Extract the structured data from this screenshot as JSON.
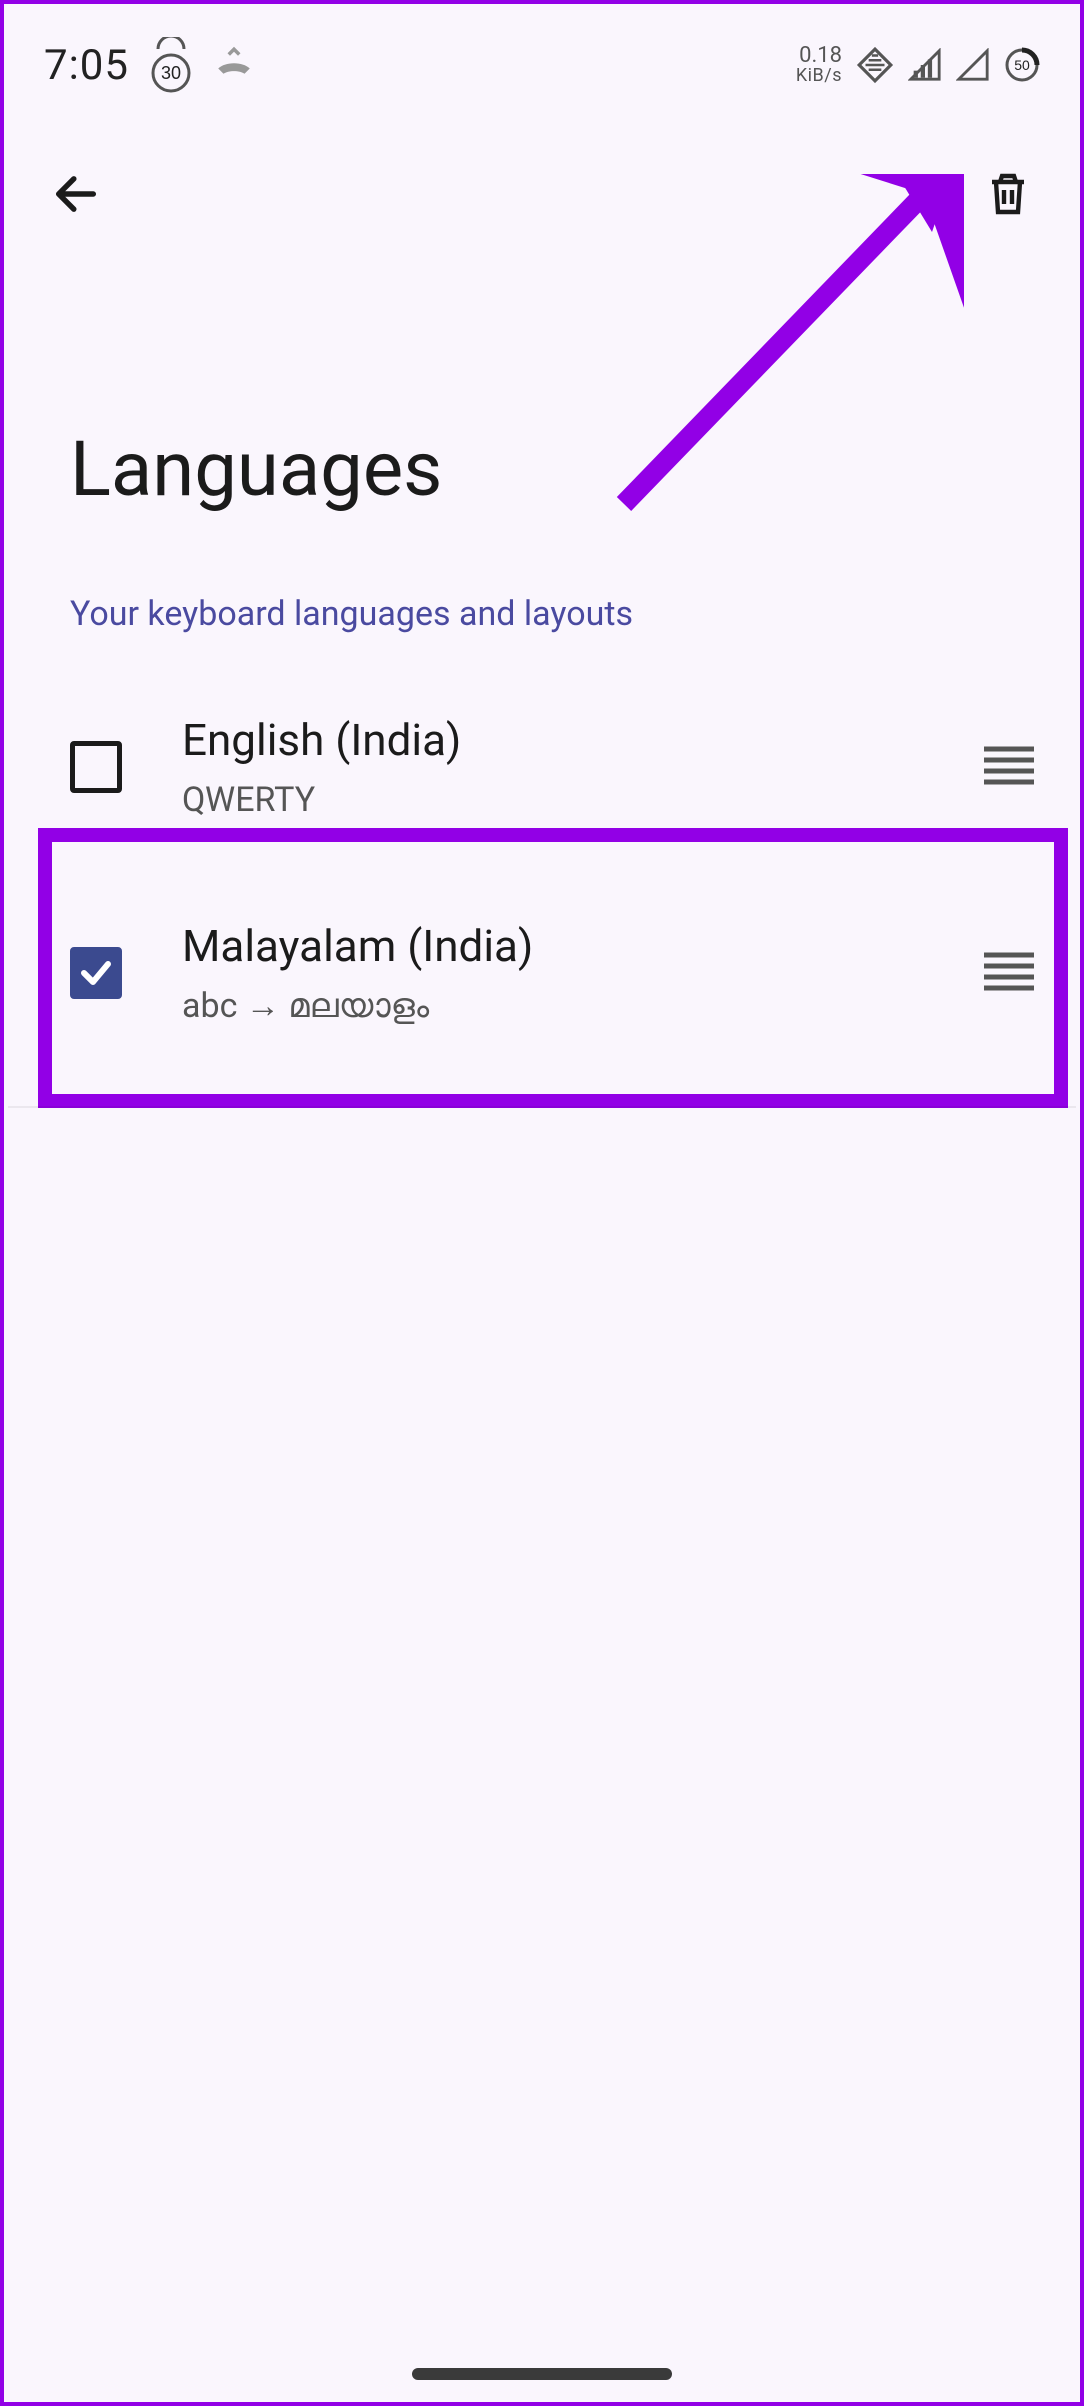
{
  "status": {
    "time": "7:05",
    "calendar_badge": "30",
    "netspeed_value": "0.18",
    "netspeed_unit": "KiB/s",
    "battery_pct": "50"
  },
  "page": {
    "title": "Languages",
    "subhead": "Your keyboard languages and layouts"
  },
  "languages": [
    {
      "name": "English (India)",
      "layout": "QWERTY",
      "checked": false
    },
    {
      "name": "Malayalam (India)",
      "layout": "abc → മലയാളം",
      "checked": true
    }
  ]
}
